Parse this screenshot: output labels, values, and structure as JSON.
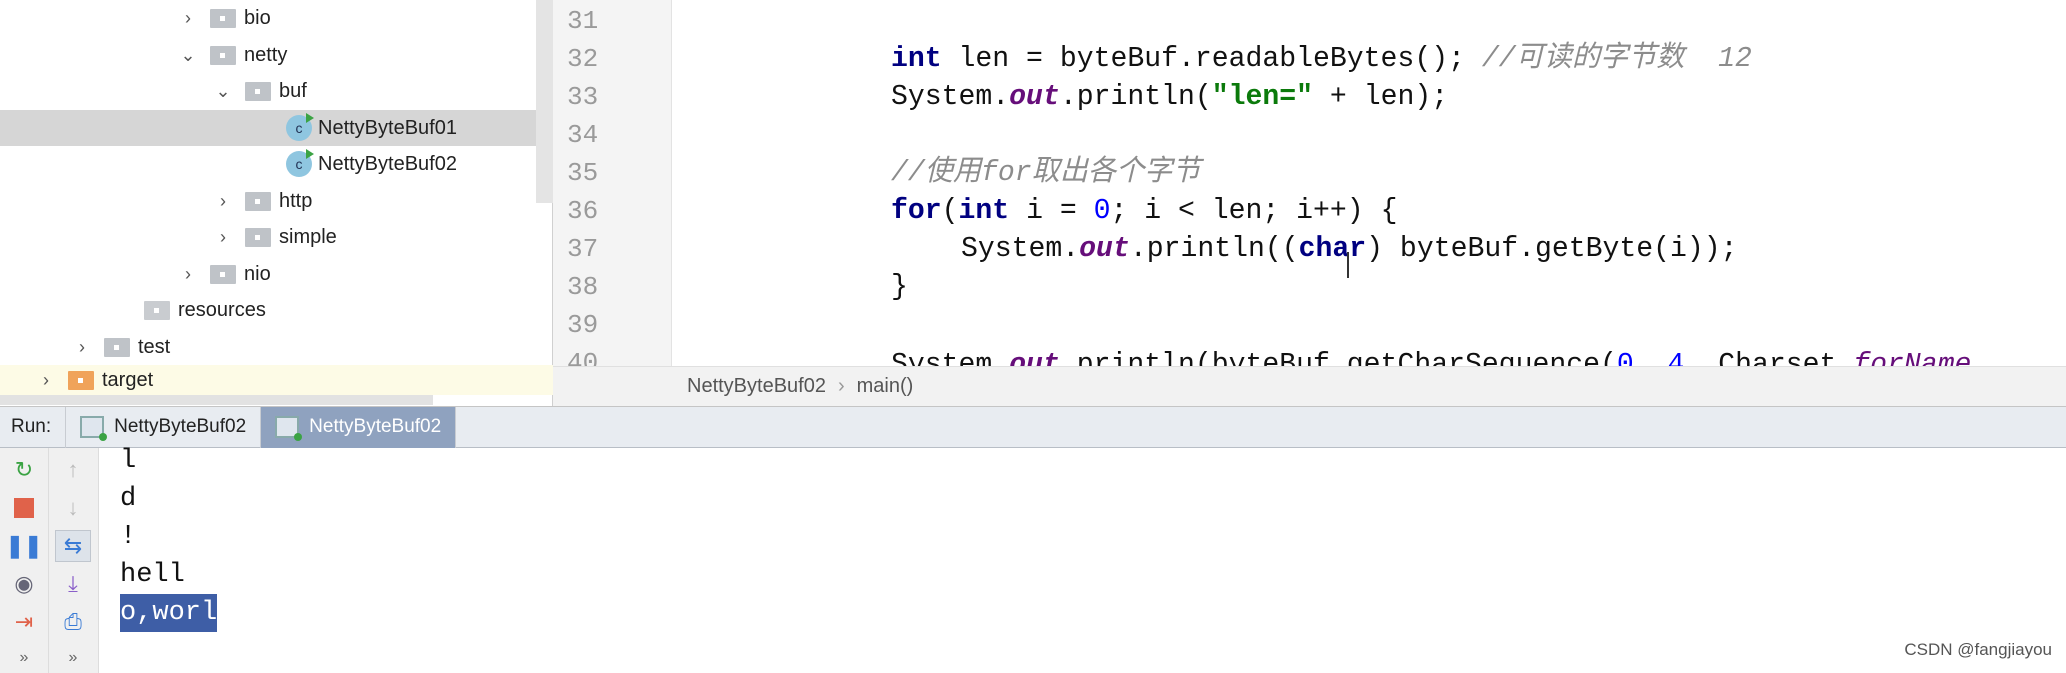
{
  "tree": [
    {
      "label": "bio",
      "type": "folder",
      "expanded": false
    },
    {
      "label": "netty",
      "type": "folder",
      "expanded": true
    },
    {
      "label": "buf",
      "type": "folder",
      "expanded": true
    },
    {
      "label": "NettyByteBuf01",
      "type": "class",
      "selected": true
    },
    {
      "label": "NettyByteBuf02",
      "type": "class"
    },
    {
      "label": "http",
      "type": "folder",
      "expanded": false
    },
    {
      "label": "simple",
      "type": "folder",
      "expanded": false
    },
    {
      "label": "nio",
      "type": "folder",
      "expanded": false
    },
    {
      "label": "resources",
      "type": "resources"
    },
    {
      "label": "test",
      "type": "folder",
      "expanded": false
    },
    {
      "label": "target",
      "type": "excluded-folder",
      "expanded": false
    }
  ],
  "editor": {
    "line_numbers": [
      "31",
      "32",
      "33",
      "34",
      "35",
      "36",
      "37",
      "38",
      "39",
      "40"
    ],
    "code": {
      "l32a": "int",
      " l32b": "",
      "l32_rest": " len = byteBuf.readableBytes(); ",
      "l32_comment": "//可读的字节数  12",
      "l33a": "System.",
      "l33b": "out",
      "l33c": ".println(",
      "l33d": "\"len=\"",
      "l33e": " + len);",
      "l35": "//使用for取出各个字节",
      "l36a": "for",
      "l36b": "(",
      "l36c": "int",
      "l36d": " i = ",
      "l36e": "0",
      "l36f": "; i < len; i++) {",
      "l37a": "System.",
      "l37b": "out",
      "l37c": ".println((",
      "l37d": "char",
      "l37e": ") byteBuf.getByte(i));",
      "l38": "}",
      "l40a": "System.",
      "l40b": "out",
      "l40c": ".println(byteBuf.getCharSequence(",
      "l40d": "0",
      ", l40e": "",
      "l40f": ", ",
      "l40g": "4",
      "l40h": ", Charset.",
      "l40i": "forName"
    },
    "breadcrumb": [
      "NettyByteBuf02",
      "main()"
    ]
  },
  "run": {
    "label": "Run:",
    "tabs": [
      {
        "label": "NettyByteBuf02",
        "selected": false
      },
      {
        "label": "NettyByteBuf02",
        "selected": true
      }
    ],
    "output": [
      "l",
      "d",
      "!",
      "hell",
      "o,worl"
    ],
    "selected_output": "o,worl"
  },
  "watermark": "CSDN @fangjiayou"
}
